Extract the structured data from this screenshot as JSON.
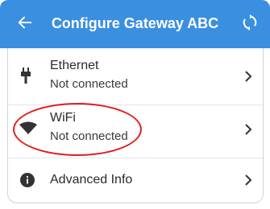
{
  "header": {
    "title": "Configure Gateway ABC",
    "back_icon": "arrow-left-icon",
    "action_icon": "sync-icon",
    "background": "#3b8fe0"
  },
  "items": [
    {
      "label": "Ethernet",
      "status": "Not connected",
      "icon": "ethernet-plug-icon"
    },
    {
      "label": "WiFi",
      "status": "Not connected",
      "icon": "wifi-icon"
    },
    {
      "label": "Advanced Info",
      "icon": "info-icon"
    }
  ],
  "colors": {
    "highlight": "#e01f1f"
  }
}
